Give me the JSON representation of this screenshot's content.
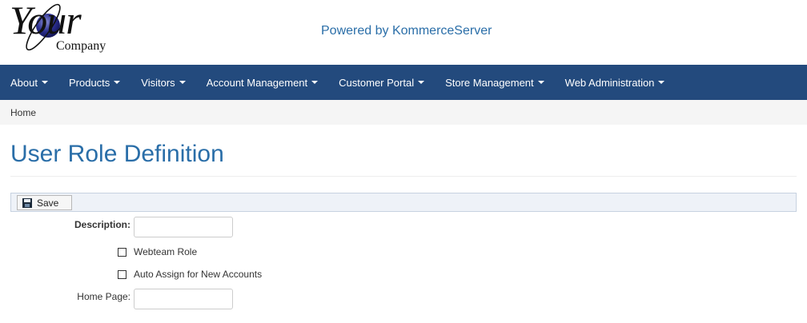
{
  "logo": {
    "your": "Your",
    "company": "Company"
  },
  "header": {
    "powered_by": "Powered by KommerceServer"
  },
  "nav": {
    "items": [
      {
        "label": "About"
      },
      {
        "label": "Products"
      },
      {
        "label": "Visitors"
      },
      {
        "label": "Account Management"
      },
      {
        "label": "Customer Portal"
      },
      {
        "label": "Store Management"
      },
      {
        "label": "Web Administration"
      }
    ]
  },
  "breadcrumb": {
    "home": "Home"
  },
  "page": {
    "title": "User Role Definition"
  },
  "toolbar": {
    "save_label": "Save"
  },
  "form": {
    "description_label": "Description:",
    "description_value": "",
    "webteam_label": "Webteam Role",
    "webteam_checked": false,
    "auto_assign_label": "Auto Assign for New Accounts",
    "auto_assign_checked": false,
    "home_page_label": "Home Page:",
    "home_page_value": ""
  },
  "colors": {
    "navbar": "#234a7d",
    "accent": "#2a6ea8",
    "breadcrumb_bg": "#f5f5f5",
    "toolbar_bg": "#eef2f8"
  }
}
